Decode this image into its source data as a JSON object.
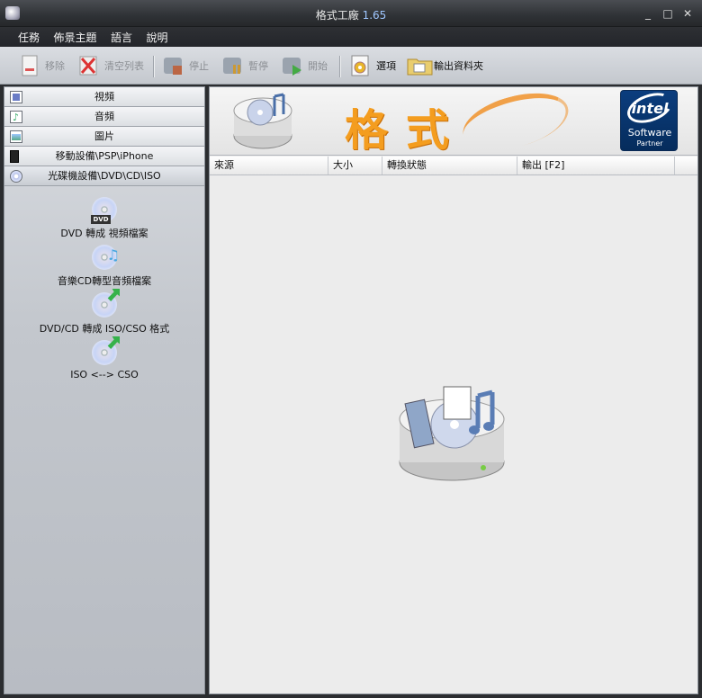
{
  "window": {
    "title": "格式工廠",
    "version": "1.65",
    "minimize": "_",
    "maximize": "□",
    "close": "✕"
  },
  "menu": [
    "任務",
    "佈景主題",
    "語言",
    "說明"
  ],
  "toolbar": {
    "remove": "移除",
    "clear": "清空列表",
    "stop": "停止",
    "pause": "暫停",
    "start": "開始",
    "options": "選項",
    "output_folder": "輸出資料夾"
  },
  "sidebar": {
    "categories": [
      {
        "label": "視頻",
        "icon": "video-icon"
      },
      {
        "label": "音頻",
        "icon": "audio-icon"
      },
      {
        "label": "圖片",
        "icon": "picture-icon"
      },
      {
        "label": "移動設備\\PSP\\iPhone",
        "icon": "mobile-icon"
      },
      {
        "label": "光碟機設備\\DVD\\CD\\ISO",
        "icon": "disc-icon"
      }
    ],
    "tools": [
      {
        "label": "DVD 轉成 視頻檔案",
        "icon": "dvd-to-video-icon",
        "badge": "DVD"
      },
      {
        "label": "音樂CD轉型音頻檔案",
        "icon": "cd-to-audio-icon"
      },
      {
        "label": "DVD/CD 轉成 ISO/CSO 格式",
        "icon": "dvd-to-iso-icon"
      },
      {
        "label": "ISO <--> CSO",
        "icon": "iso-cso-icon"
      }
    ]
  },
  "banner": {
    "title": "格式",
    "partner": {
      "brand": "intel",
      "line1": "Software",
      "line2": "Partner"
    }
  },
  "table": {
    "columns": [
      "來源",
      "大小",
      "轉換狀態",
      "輸出 [F2]"
    ]
  },
  "colors": {
    "accent": "#f49d1f",
    "intel_blue": "#0b3d7e"
  }
}
